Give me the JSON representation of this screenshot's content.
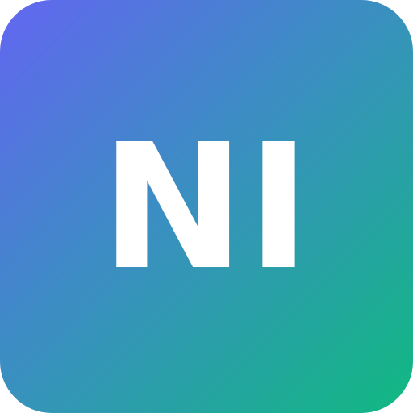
{
  "icon": {
    "initials": "NI",
    "text_color": "#ffffff",
    "gradient_start": "#6366f1",
    "gradient_end": "#10b981"
  }
}
